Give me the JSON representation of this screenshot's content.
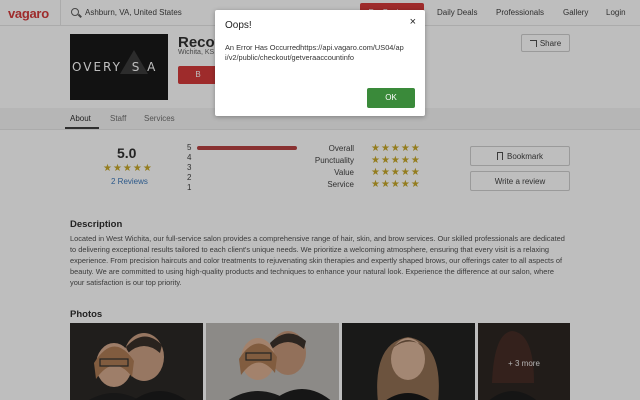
{
  "header": {
    "logo": "vagaro",
    "search_value": "Ashburn, VA, United States",
    "for_business": "For Business",
    "nav": [
      "Daily Deals",
      "Professionals",
      "Gallery",
      "Login"
    ]
  },
  "business": {
    "logo_text": "OVERY  S A",
    "name": "Recov",
    "location": "Wichita, KS",
    "book_label": "B",
    "share_label": "Share"
  },
  "tabs": [
    "About",
    "Staff",
    "Services"
  ],
  "ratings": {
    "overall": "5.0",
    "stars": "★★★★★",
    "reviews_link": "2 Reviews",
    "distribution": [
      {
        "label": "5",
        "fraction": 1.0
      },
      {
        "label": "4",
        "fraction": 0
      },
      {
        "label": "3",
        "fraction": 0
      },
      {
        "label": "2",
        "fraction": 0
      },
      {
        "label": "1",
        "fraction": 0
      }
    ],
    "categories": [
      {
        "label": "Overall",
        "stars": "★★★★★"
      },
      {
        "label": "Punctuality",
        "stars": "★★★★★"
      },
      {
        "label": "Value",
        "stars": "★★★★★"
      },
      {
        "label": "Service",
        "stars": "★★★★★"
      }
    ]
  },
  "actions": {
    "bookmark": "Bookmark",
    "write_review": "Write a review"
  },
  "description": {
    "title": "Description",
    "text": "Located in West Wichita, our full-service salon provides a comprehensive range of hair, skin, and brow services. Our skilled professionals are dedicated to delivering exceptional results tailored to each client's unique needs. We prioritize a welcoming atmosphere, ensuring that every visit is a relaxing experience. From precision haircuts and color treatments to rejuvenating skin therapies and expertly shaped brows, our offerings cater to all aspects of beauty. We are committed to using high-quality products and techniques to enhance your natural look. Experience the difference at our salon, where your satisfaction is our top priority."
  },
  "photos": {
    "title": "Photos",
    "more_label": "+ 3 more"
  },
  "modal": {
    "title": "Oops!",
    "close": "×",
    "body": "An Error Has Occurredhttps://api.vagaro.com/US04/api/v2/public/checkout/getveraaccountinfo",
    "ok": "OK"
  },
  "colors": {
    "brand": "#d12d2d",
    "star": "#c3a21c",
    "link": "#2f6fb5",
    "ok": "#3a8a3a"
  }
}
